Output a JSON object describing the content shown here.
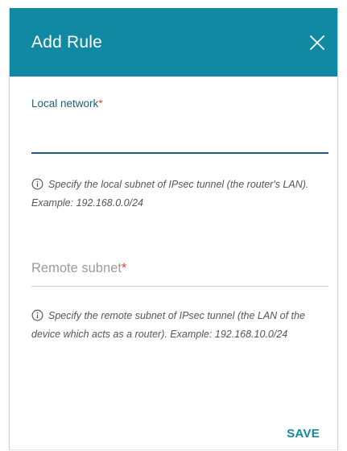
{
  "dialog": {
    "title": "Add Rule",
    "close_icon": "close-icon",
    "header_color": "#1289a3"
  },
  "local_network": {
    "label": "Local network",
    "required_mark": "*",
    "value": "",
    "hint": "Specify the local subnet of IPsec tunnel (the router's LAN). Example: 192.168.0.0/24",
    "hint_icon": "info-icon"
  },
  "remote_subnet": {
    "label": "Remote subnet",
    "required_mark": "*",
    "value": "",
    "hint": "Specify the remote subnet of IPsec tunnel (the LAN of the device which acts as a router). Example: 192.168.10.0/24",
    "hint_icon": "info-icon"
  },
  "actions": {
    "save_label": "SAVE",
    "accent_color": "#1289a3",
    "required_color": "#e0483a"
  }
}
